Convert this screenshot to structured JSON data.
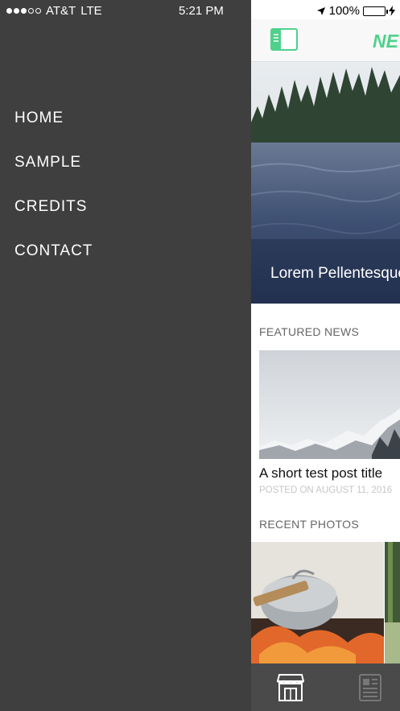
{
  "status": {
    "carrier": "AT&T",
    "network": "LTE",
    "time": "5:21 PM",
    "battery": "100%",
    "signal_bars_filled": 3,
    "signal_bars_total": 5
  },
  "drawer": {
    "menu": [
      "HOME",
      "SAMPLE",
      "CREDITS",
      "CONTACT"
    ]
  },
  "header": {
    "brand": "NEWS"
  },
  "hero": {
    "caption": "Lorem Pellentesque"
  },
  "featured": {
    "section_label": "FEATURED NEWS",
    "post_title": "A short test post title",
    "post_meta": "POSTED ON AUGUST 11, 2016"
  },
  "recent": {
    "section_label": "RECENT PHOTOS"
  },
  "tabbar": {
    "icons": [
      "store-icon",
      "newspaper-icon"
    ]
  },
  "colors": {
    "accent": "#4fd18b",
    "drawer_bg": "#3f3f3f",
    "tabbar_bg": "#4a4a4a"
  }
}
